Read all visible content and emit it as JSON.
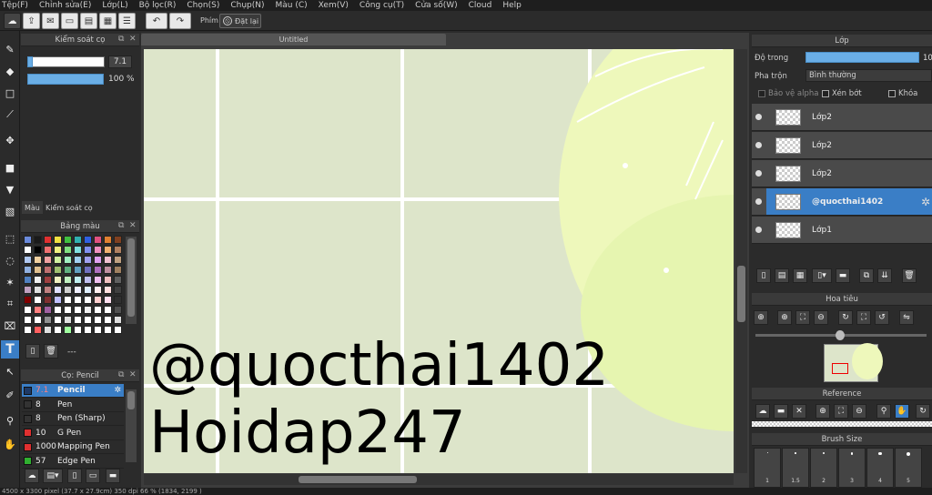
{
  "menu": [
    "Tệp(F)",
    "Chỉnh sửa(E)",
    "Lớp(L)",
    "Bộ lọc(R)",
    "Chọn(S)",
    "Chụp(N)",
    "Màu (C)",
    "Xem(V)",
    "Công cụ(T)",
    "Cửa số(W)",
    "Cloud",
    "Help"
  ],
  "toolbar": {
    "phim_label": "Phím",
    "reset_label": "Đặt lại"
  },
  "brush_control": {
    "title": "Kiểm soát cọ",
    "size_value": "7.1",
    "opacity_value": "100 %"
  },
  "left_tabs": {
    "color": "Màu",
    "brush_control": "Kiểm soát cọ"
  },
  "palette": {
    "title": "Bảng màu",
    "footer_text": "---"
  },
  "brush_list": {
    "title": "Cọ: Pencil",
    "items": [
      {
        "size": "7.1",
        "name": "Pencil",
        "color": "#1e3a66",
        "selected": true
      },
      {
        "size": "8",
        "name": "Pen",
        "color": "#333333",
        "selected": false
      },
      {
        "size": "8",
        "name": "Pen (Sharp)",
        "color": "#333333",
        "selected": false
      },
      {
        "size": "10",
        "name": "G Pen",
        "color": "#e03030",
        "selected": false
      },
      {
        "size": "1000",
        "name": "Mapping Pen",
        "color": "#e03030",
        "selected": false
      },
      {
        "size": "57",
        "name": "Edge Pen",
        "color": "#30b030",
        "selected": false
      }
    ]
  },
  "document": {
    "tab_title": "Untitled",
    "text_line1": "@quocthai1402",
    "text_line2": "Hoidap247"
  },
  "layer_panel": {
    "title": "Lớp",
    "opacity_label": "Độ trong",
    "opacity_value": "10",
    "blend_label": "Pha trộn",
    "blend_value": "Bình thường",
    "protect_alpha": "Bảo vệ alpha",
    "clipping": "Xén bớt",
    "lock": "Khóa",
    "layers": [
      {
        "name": "Lớp2",
        "selected": false
      },
      {
        "name": "Lớp2",
        "selected": false
      },
      {
        "name": "Lớp2",
        "selected": false
      },
      {
        "name": "@quocthai1402",
        "selected": true
      },
      {
        "name": "Lớp1",
        "selected": false
      }
    ]
  },
  "navigator": {
    "title": "Hoa tiêu"
  },
  "reference": {
    "title": "Reference"
  },
  "brush_size": {
    "title": "Brush Size",
    "sizes": [
      "1",
      "1.5",
      "2",
      "3",
      "4",
      "5"
    ]
  },
  "status": {
    "text": "4500 x 3300 pixel   (37.7 x 27.9cm)   350 dpi   66 %   (1834, 2199 )"
  },
  "colors": {
    "accent": "#3a7ec6",
    "canvas_bg": "#dde5ca",
    "blob": "#eef8bb"
  }
}
